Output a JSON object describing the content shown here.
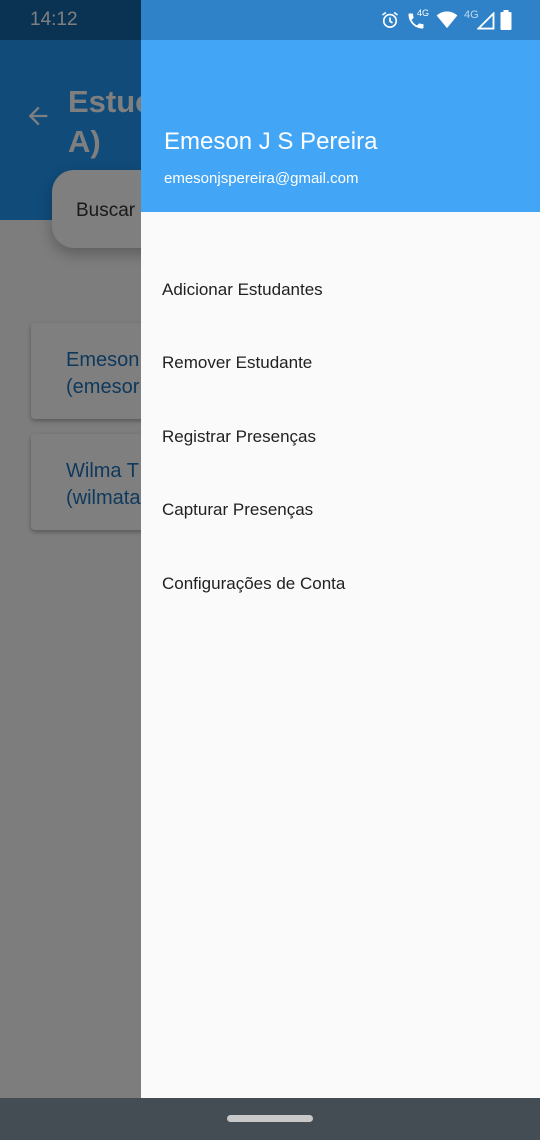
{
  "status_bar": {
    "time": "14:12",
    "icons": [
      "alarm-icon",
      "wifi-calling-icon",
      "wifi-icon",
      "signal-4g-icon",
      "battery-icon"
    ],
    "signal_label": "4G",
    "call_label": "4G"
  },
  "background_screen": {
    "title": "Estuc\nA)",
    "search_placeholder": "Buscar",
    "students": [
      {
        "line1": "Emeson",
        "line2": "(emesor"
      },
      {
        "line1": "Wilma T",
        "line2": "(wilmata"
      }
    ]
  },
  "drawer": {
    "account_name": "Emeson J S Pereira",
    "account_email": "emesonjspereira@gmail.com",
    "menu": [
      {
        "label": "Adicionar Estudantes"
      },
      {
        "label": "Remover Estudante"
      },
      {
        "label": "Registrar Presenças"
      },
      {
        "label": "Capturar Presenças"
      },
      {
        "label": "Configurações de Conta"
      }
    ]
  },
  "colors": {
    "primary": "#2196f3",
    "drawer_header": "#42a5f5",
    "status_bar": "#2f82c8"
  }
}
